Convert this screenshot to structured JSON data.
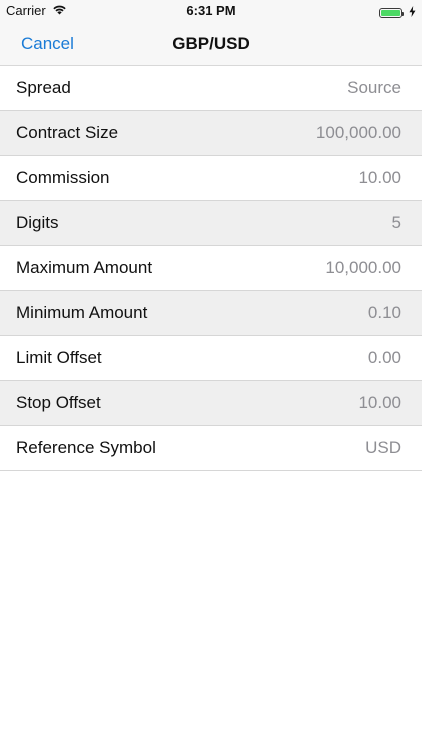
{
  "status_bar": {
    "carrier": "Carrier",
    "time": "6:31 PM",
    "battery_level": 1.0,
    "battery_color": "#4cd964"
  },
  "nav": {
    "cancel_label": "Cancel",
    "title": "GBP/USD",
    "accent_color": "#1a7bd6"
  },
  "rows": [
    {
      "label": "Spread",
      "value": "Source"
    },
    {
      "label": "Contract Size",
      "value": "100,000.00"
    },
    {
      "label": "Commission",
      "value": "10.00"
    },
    {
      "label": "Digits",
      "value": "5"
    },
    {
      "label": "Maximum Amount",
      "value": "10,000.00"
    },
    {
      "label": "Minimum Amount",
      "value": "0.10"
    },
    {
      "label": "Limit Offset",
      "value": "0.00"
    },
    {
      "label": "Stop Offset",
      "value": "10.00"
    },
    {
      "label": "Reference Symbol",
      "value": "USD"
    }
  ]
}
